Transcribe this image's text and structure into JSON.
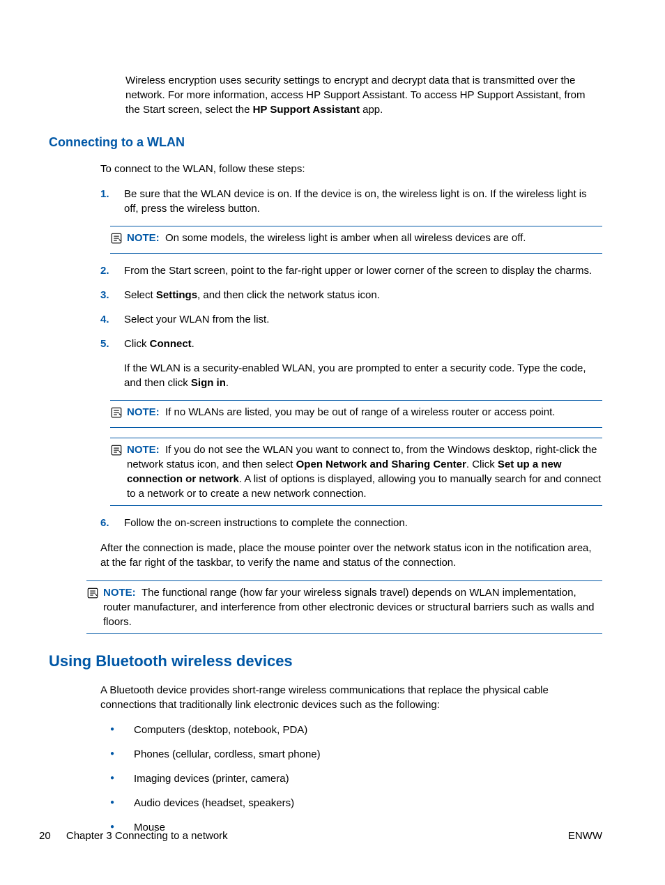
{
  "intro": {
    "part1": "Wireless encryption uses security settings to encrypt and decrypt data that is transmitted over the network. For more information, access HP Support Assistant. To access HP Support Assistant, from the Start screen, select the ",
    "bold": "HP Support Assistant",
    "part2": " app."
  },
  "section1": {
    "heading": "Connecting to a WLAN",
    "lead": "To connect to the WLAN, follow these steps:",
    "steps": {
      "n1": "1.",
      "t1": "Be sure that the WLAN device is on. If the device is on, the wireless light is on. If the wireless light is off, press the wireless button.",
      "note1_label": "NOTE:",
      "note1": "On some models, the wireless light is amber when all wireless devices are off.",
      "n2": "2.",
      "t2": "From the Start screen, point to the far-right upper or lower corner of the screen to display the charms.",
      "n3": "3.",
      "t3a": "Select ",
      "t3b": "Settings",
      "t3c": ", and then click the network status icon.",
      "n4": "4.",
      "t4": "Select your WLAN from the list.",
      "n5": "5.",
      "t5a": "Click ",
      "t5b": "Connect",
      "t5c": ".",
      "t5_sub_a": "If the WLAN is a security-enabled WLAN, you are prompted to enter a security code. Type the code, and then click ",
      "t5_sub_b": "Sign in",
      "t5_sub_c": ".",
      "note2_label": "NOTE:",
      "note2": "If no WLANs are listed, you may be out of range of a wireless router or access point.",
      "note3_label": "NOTE:",
      "note3_a": "If you do not see the WLAN you want to connect to, from the Windows desktop, right-click the network status icon, and then select ",
      "note3_b": "Open Network and Sharing Center",
      "note3_c": ". Click ",
      "note3_d": "Set up a new connection or network",
      "note3_e": ". A list of options is displayed, allowing you to manually search for and connect to a network or to create a new network connection.",
      "n6": "6.",
      "t6": "Follow the on-screen instructions to complete the connection."
    },
    "after": "After the connection is made, place the mouse pointer over the network status icon in the notification area, at the far right of the taskbar, to verify the name and status of the connection.",
    "note4_label": "NOTE:",
    "note4": "The functional range (how far your wireless signals travel) depends on WLAN implementation, router manufacturer, and interference from other electronic devices or structural barriers such as walls and floors."
  },
  "section2": {
    "heading": "Using Bluetooth wireless devices",
    "lead": "A Bluetooth device provides short-range wireless communications that replace the physical cable connections that traditionally link electronic devices such as the following:",
    "bullets": {
      "b1": "Computers (desktop, notebook, PDA)",
      "b2": "Phones (cellular, cordless, smart phone)",
      "b3": "Imaging devices (printer, camera)",
      "b4": "Audio devices (headset, speakers)",
      "b5": "Mouse"
    }
  },
  "footer": {
    "page": "20",
    "chapter": "Chapter 3   Connecting to a network",
    "right": "ENWW"
  }
}
